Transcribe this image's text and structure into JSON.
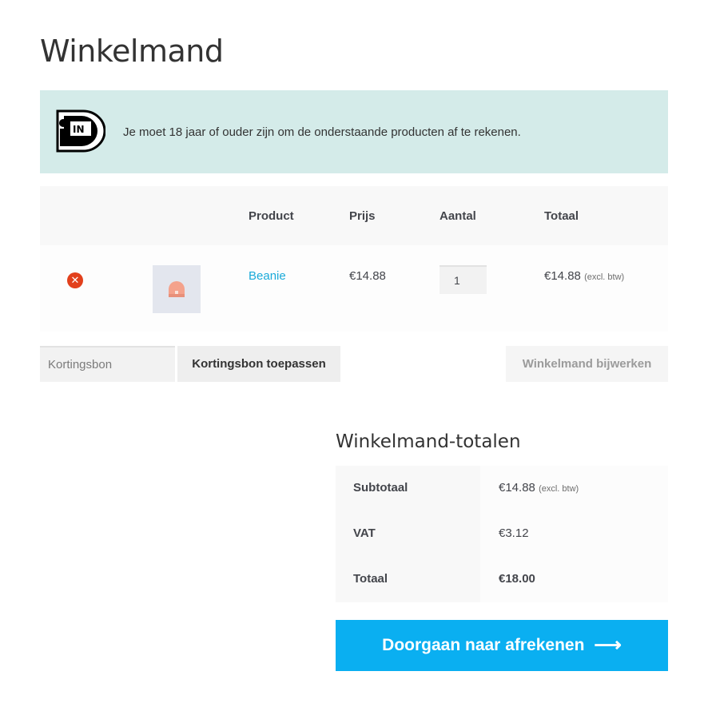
{
  "page": {
    "title": "Winkelmand"
  },
  "notice": {
    "logo_text": "iDIN",
    "text": "Je moet 18 jaar of ouder zijn om de onderstaande producten af te rekenen."
  },
  "cart": {
    "headers": {
      "product": "Product",
      "price": "Prijs",
      "quantity": "Aantal",
      "total": "Totaal"
    },
    "items": [
      {
        "name": "Beanie",
        "price": "€14.88",
        "quantity": "1",
        "total": "€14.88",
        "total_note": "(excl. btw)"
      }
    ]
  },
  "actions": {
    "coupon_placeholder": "Kortingsbon",
    "apply_coupon": "Kortingsbon toepassen",
    "update_cart": "Winkelmand bijwerken"
  },
  "totals": {
    "title": "Winkelmand-totalen",
    "subtotal_label": "Subtotaal",
    "subtotal_value": "€14.88",
    "subtotal_note": "(excl. btw)",
    "vat_label": "VAT",
    "vat_value": "€3.12",
    "total_label": "Totaal",
    "total_value": "€18.00"
  },
  "checkout": {
    "label": "Doorgaan naar afrekenen",
    "arrow": "⟶"
  },
  "colors": {
    "accent": "#0aaff1",
    "link": "#1aaad9",
    "remove": "#e2401c",
    "notice_bg": "#d4ebe9"
  }
}
